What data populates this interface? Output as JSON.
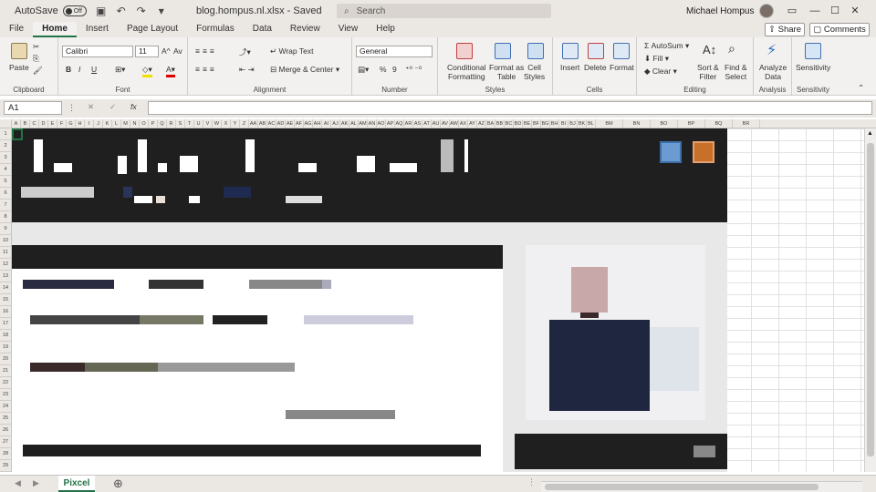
{
  "titlebar": {
    "autosave_label": "AutoSave",
    "autosave_state": "Off",
    "document_title": "blog.hompus.nl.xlsx  -  Saved",
    "search_placeholder": "Search",
    "user_name": "Michael Hompus"
  },
  "ribbon_tabs": [
    "File",
    "Home",
    "Insert",
    "Page Layout",
    "Formulas",
    "Data",
    "Review",
    "View",
    "Help"
  ],
  "share_label": "Share",
  "comments_label": "Comments",
  "ribbon": {
    "clipboard": {
      "paste": "Paste",
      "group": "Clipboard"
    },
    "font": {
      "name": "Calibri",
      "size": "11",
      "bold": "B",
      "italic": "I",
      "underline": "U",
      "grow": "A^",
      "shrink": "Av",
      "group": "Font"
    },
    "alignment": {
      "wrap": "Wrap Text",
      "merge": "Merge & Center",
      "group": "Alignment"
    },
    "number": {
      "format": "General",
      "percent": "%",
      "comma": "9",
      "group": "Number"
    },
    "styles": {
      "conditional_1": "Conditional",
      "conditional_2": "Formatting",
      "format_table_1": "Format as",
      "format_table_2": "Table",
      "cell_styles_1": "Cell",
      "cell_styles_2": "Styles",
      "group": "Styles"
    },
    "cells": {
      "insert": "Insert",
      "delete": "Delete",
      "format": "Format",
      "group": "Cells"
    },
    "editing": {
      "autosum": "AutoSum",
      "fill": "Fill",
      "clear": "Clear",
      "sort_1": "Sort &",
      "sort_2": "Filter",
      "find_1": "Find &",
      "find_2": "Select",
      "group": "Editing"
    },
    "analysis": {
      "analyze_1": "Analyze",
      "analyze_2": "Data",
      "group": "Analysis"
    },
    "sensitivity": {
      "label": "Sensitivity",
      "group": "Sensitivity"
    }
  },
  "formula_bar": {
    "name_box": "A1",
    "fx": "fx",
    "value": ""
  },
  "columns": [
    "A",
    "B",
    "C",
    "D",
    "E",
    "F",
    "G",
    "H",
    "I",
    "J",
    "K",
    "L",
    "M",
    "N",
    "O",
    "P",
    "Q",
    "R",
    "S",
    "T",
    "U",
    "V",
    "W",
    "X",
    "Y",
    "Z",
    "AA",
    "AB",
    "AC",
    "AD",
    "AE",
    "AF",
    "AG",
    "AH",
    "AI",
    "AJ",
    "AK",
    "AL",
    "AM",
    "AN",
    "AO",
    "AP",
    "AQ",
    "AR",
    "AS",
    "AT",
    "AU",
    "AV",
    "AW",
    "AX",
    "AY",
    "AZ",
    "BA",
    "BB",
    "BC",
    "BD",
    "BE",
    "BF",
    "BG",
    "BH",
    "BI",
    "BJ",
    "BK",
    "BL",
    "BM",
    "BN",
    "BO",
    "BP",
    "BQ",
    "BR"
  ],
  "sheet_tab": "Pixcel",
  "colors": {
    "excel_green": "#217346",
    "header_dark": "#1f1f1f",
    "panel": "#e6e6e6"
  }
}
